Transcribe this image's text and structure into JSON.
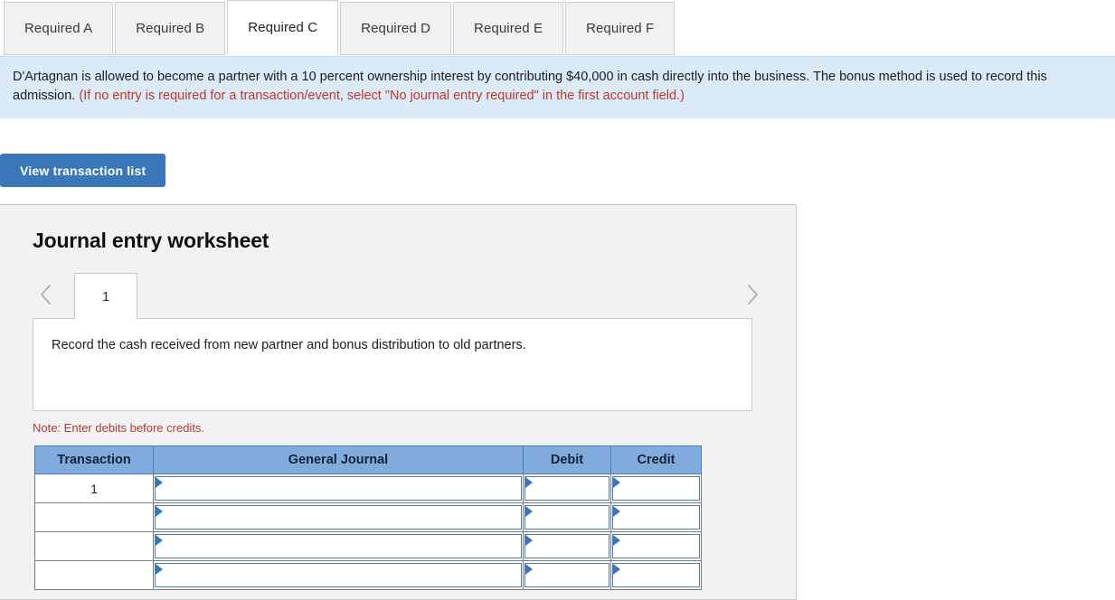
{
  "tabs": [
    {
      "label": "Required A",
      "active": false
    },
    {
      "label": "Required B",
      "active": false
    },
    {
      "label": "Required C",
      "active": true
    },
    {
      "label": "Required D",
      "active": false
    },
    {
      "label": "Required E",
      "active": false
    },
    {
      "label": "Required F",
      "active": false
    }
  ],
  "info": {
    "black_text": "D'Artagnan is allowed to become a partner with a 10 percent ownership interest by contributing $40,000 in cash directly into the business. The bonus method is used to record this admission. ",
    "red_text": "(If no entry is required for a transaction/event, select \"No journal entry required\" in the first account field.)",
    "background_color": "#daeaf7",
    "red_color": "#c0392b"
  },
  "toolbar": {
    "view_transaction_list_label": "View transaction list",
    "button_color": "#3a77b8"
  },
  "worksheet": {
    "title": "Journal entry worksheet",
    "pager": {
      "prev_icon": "chevron-left-icon",
      "next_icon": "chevron-right-icon",
      "pages": [
        "1"
      ],
      "active_page": "1"
    },
    "description": "Record the cash received from new partner and bonus distribution to old partners.",
    "note": "Note: Enter debits before credits.",
    "table": {
      "headers": [
        "Transaction",
        "General Journal",
        "Debit",
        "Credit"
      ],
      "header_color": "#7fabdd",
      "rows": [
        {
          "transaction": "1",
          "general_journal": "",
          "debit": "",
          "credit": ""
        },
        {
          "transaction": "",
          "general_journal": "",
          "debit": "",
          "credit": ""
        },
        {
          "transaction": "",
          "general_journal": "",
          "debit": "",
          "credit": ""
        },
        {
          "transaction": "",
          "general_journal": "",
          "debit": "",
          "credit": ""
        }
      ]
    }
  }
}
